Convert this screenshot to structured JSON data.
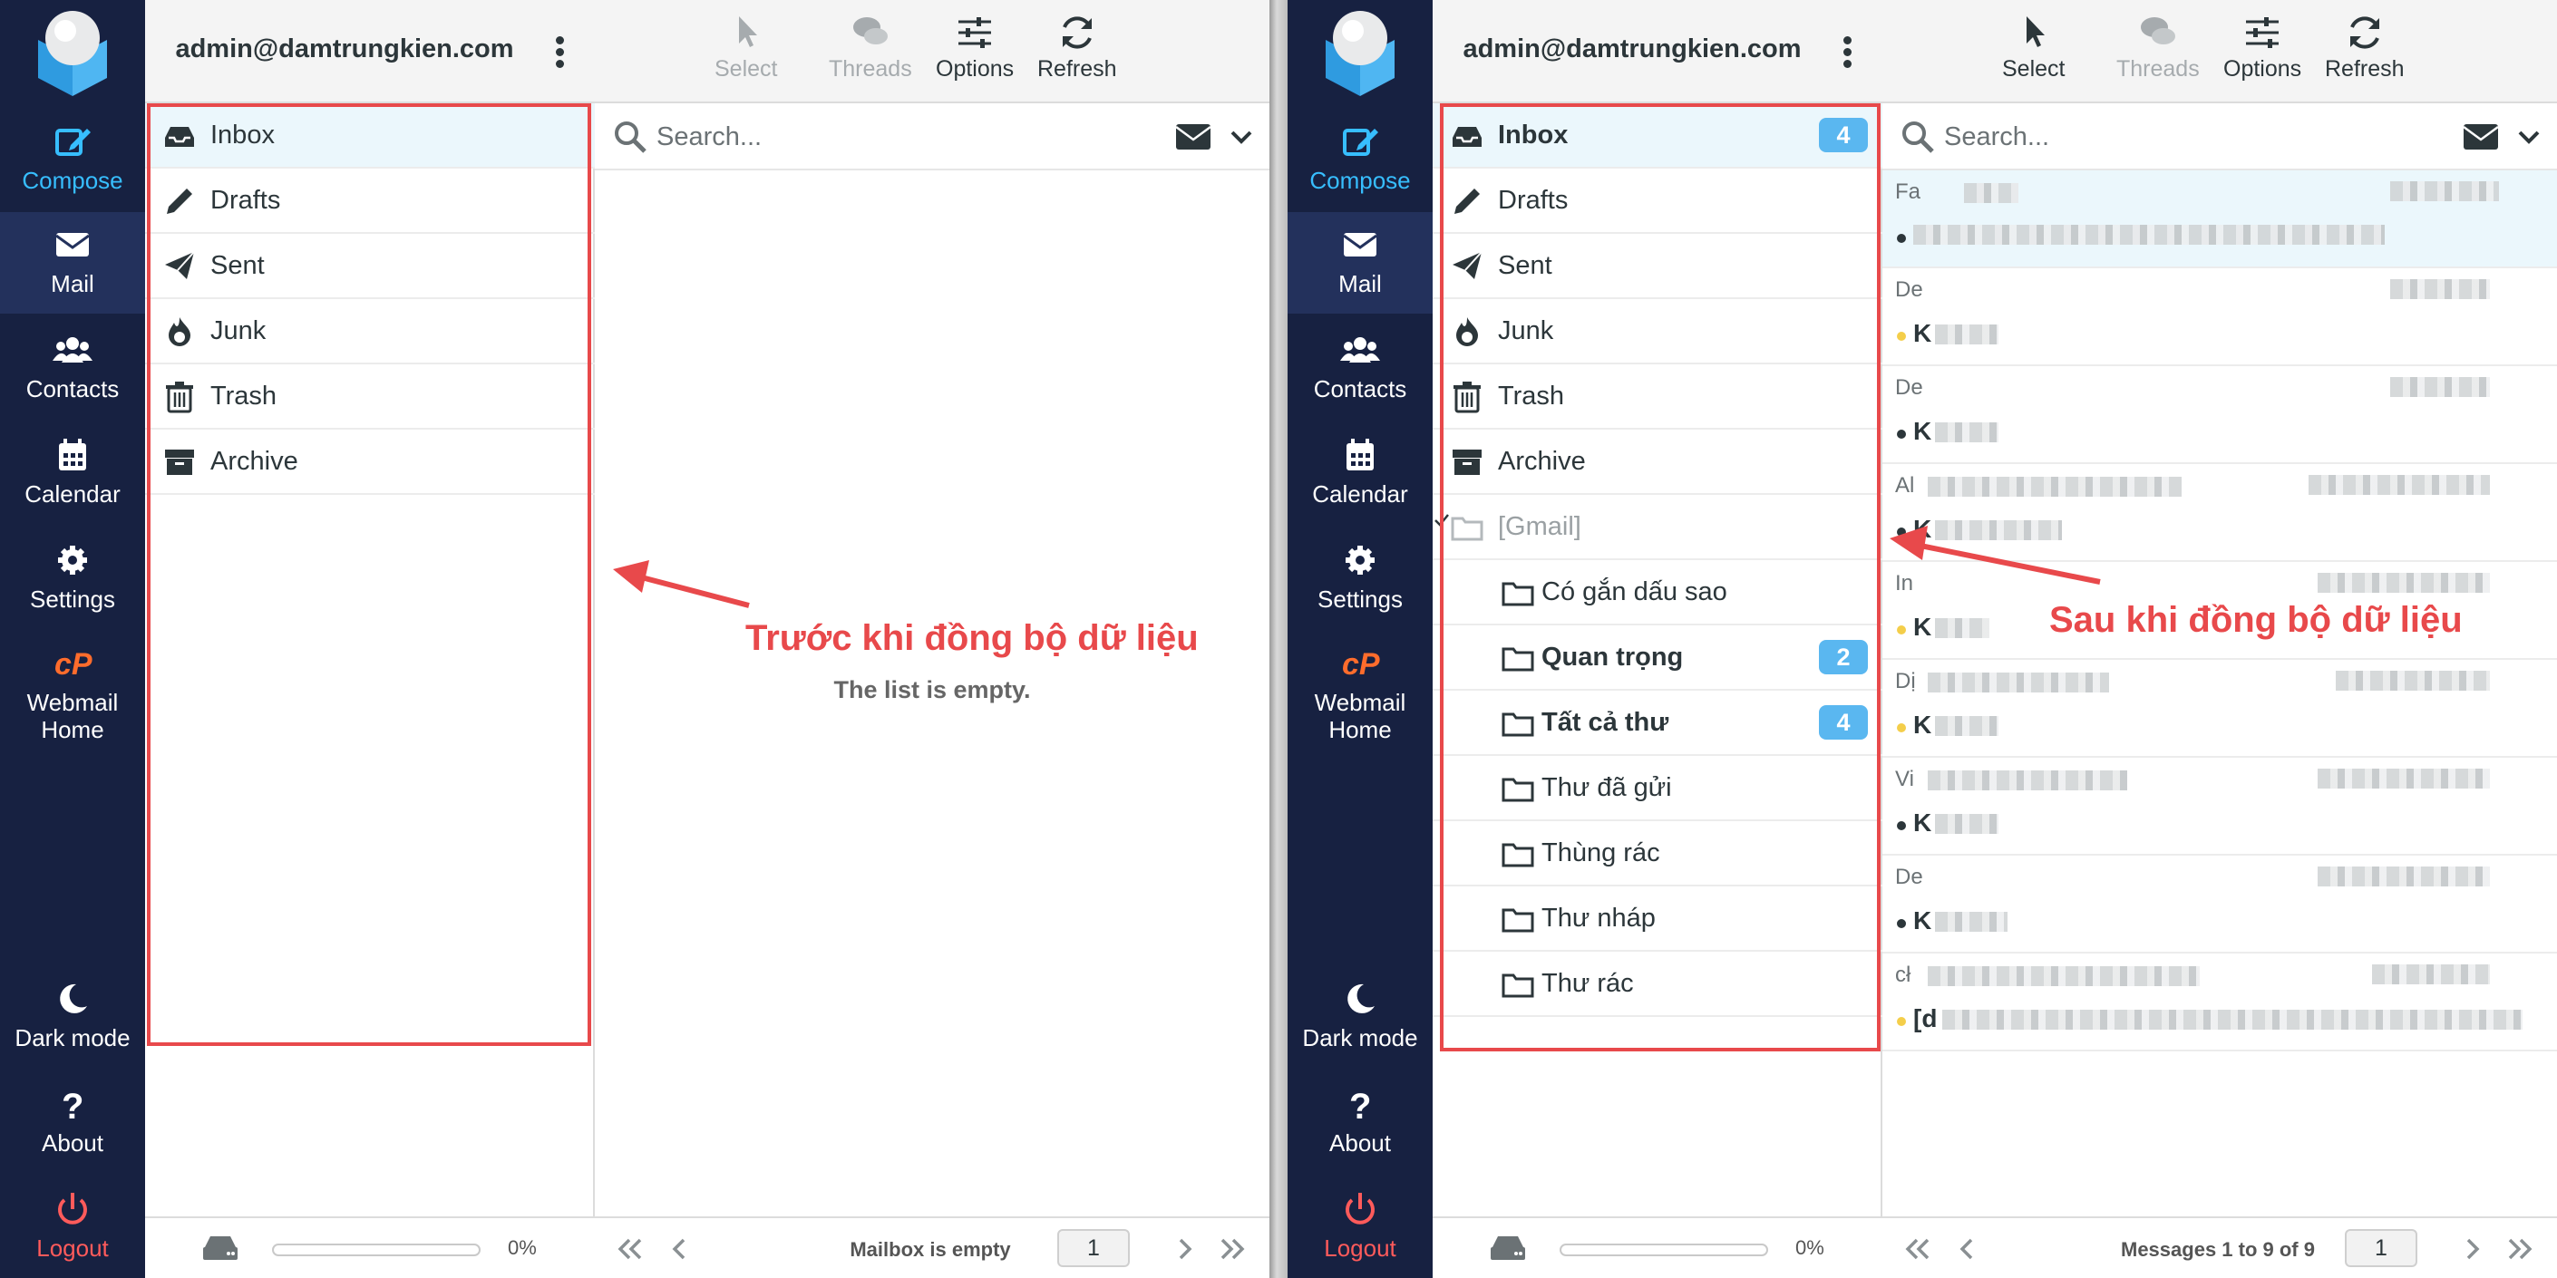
{
  "left_panel": {
    "account": "admin@damtrungkien.com",
    "nav": [
      {
        "label": "Compose",
        "icon": "compose-icon"
      },
      {
        "label": "Mail",
        "icon": "mail-icon"
      },
      {
        "label": "Contacts",
        "icon": "contacts-icon"
      },
      {
        "label": "Calendar",
        "icon": "calendar-icon"
      },
      {
        "label": "Settings",
        "icon": "gear-icon"
      },
      {
        "label": "Webmail Home",
        "icon": "cpanel-icon"
      },
      {
        "label": "Dark mode",
        "icon": "moon-icon"
      },
      {
        "label": "About",
        "icon": "question-icon"
      },
      {
        "label": "Logout",
        "icon": "power-icon"
      }
    ],
    "folders": [
      {
        "name": "Inbox",
        "icon": "inbox-icon"
      },
      {
        "name": "Drafts",
        "icon": "pencil-icon"
      },
      {
        "name": "Sent",
        "icon": "paper-plane-icon"
      },
      {
        "name": "Junk",
        "icon": "fire-icon"
      },
      {
        "name": "Trash",
        "icon": "trash-icon"
      },
      {
        "name": "Archive",
        "icon": "archive-icon"
      }
    ],
    "toolbar": {
      "select": "Select",
      "threads": "Threads",
      "options": "Options",
      "refresh": "Refresh"
    },
    "search_placeholder": "Search...",
    "empty_text": "The list is empty.",
    "quota": "0%",
    "pager_status": "Mailbox is empty",
    "page_number": "1",
    "annotation": "Trước khi đồng bộ dữ liệu"
  },
  "right_panel": {
    "account": "admin@damtrungkien.com",
    "nav": [
      {
        "label": "Compose",
        "icon": "compose-icon"
      },
      {
        "label": "Mail",
        "icon": "mail-icon"
      },
      {
        "label": "Contacts",
        "icon": "contacts-icon"
      },
      {
        "label": "Calendar",
        "icon": "calendar-icon"
      },
      {
        "label": "Settings",
        "icon": "gear-icon"
      },
      {
        "label": "Webmail Home",
        "icon": "cpanel-icon"
      },
      {
        "label": "Dark mode",
        "icon": "moon-icon"
      },
      {
        "label": "About",
        "icon": "question-icon"
      },
      {
        "label": "Logout",
        "icon": "power-icon"
      }
    ],
    "folders": [
      {
        "name": "Inbox",
        "icon": "inbox-icon",
        "badge": "4"
      },
      {
        "name": "Drafts",
        "icon": "pencil-icon"
      },
      {
        "name": "Sent",
        "icon": "paper-plane-icon"
      },
      {
        "name": "Junk",
        "icon": "fire-icon"
      },
      {
        "name": "Trash",
        "icon": "trash-icon"
      },
      {
        "name": "Archive",
        "icon": "archive-icon"
      },
      {
        "name": "[Gmail]",
        "icon": "folder-icon"
      },
      {
        "name": "Có gắn dấu sao",
        "icon": "folder-icon"
      },
      {
        "name": "Quan trọng",
        "icon": "folder-icon",
        "badge": "2"
      },
      {
        "name": "Tất cả thư",
        "icon": "folder-icon",
        "badge": "4"
      },
      {
        "name": "Thư đã gửi",
        "icon": "folder-icon"
      },
      {
        "name": "Thùng rác",
        "icon": "folder-icon"
      },
      {
        "name": "Thư nháp",
        "icon": "folder-icon"
      },
      {
        "name": "Thư rác",
        "icon": "folder-icon"
      }
    ],
    "toolbar": {
      "select": "Select",
      "threads": "Threads",
      "options": "Options",
      "refresh": "Refresh"
    },
    "search_placeholder": "Search...",
    "messages": [
      {
        "from": "Fa",
        "subject": ""
      },
      {
        "from": "De",
        "subject": "K"
      },
      {
        "from": "De",
        "subject": "K"
      },
      {
        "from": "Al",
        "subject": "K"
      },
      {
        "from": "In",
        "subject": "K"
      },
      {
        "from": "Dị",
        "subject": "K"
      },
      {
        "from": "Vi",
        "subject": "K"
      },
      {
        "from": "De",
        "subject": "K"
      },
      {
        "from": "cł",
        "subject": "[d"
      }
    ],
    "quota": "0%",
    "pager_status": "Messages 1 to 9 of 9",
    "page_number": "1",
    "annotation": "Sau khi đồng bộ dữ liệu"
  },
  "colors": {
    "nav_bg": "#172141",
    "accent": "#37beff",
    "badge": "#5ab7f0",
    "annotation": "#e8494b",
    "logout": "#ff5b5b"
  }
}
